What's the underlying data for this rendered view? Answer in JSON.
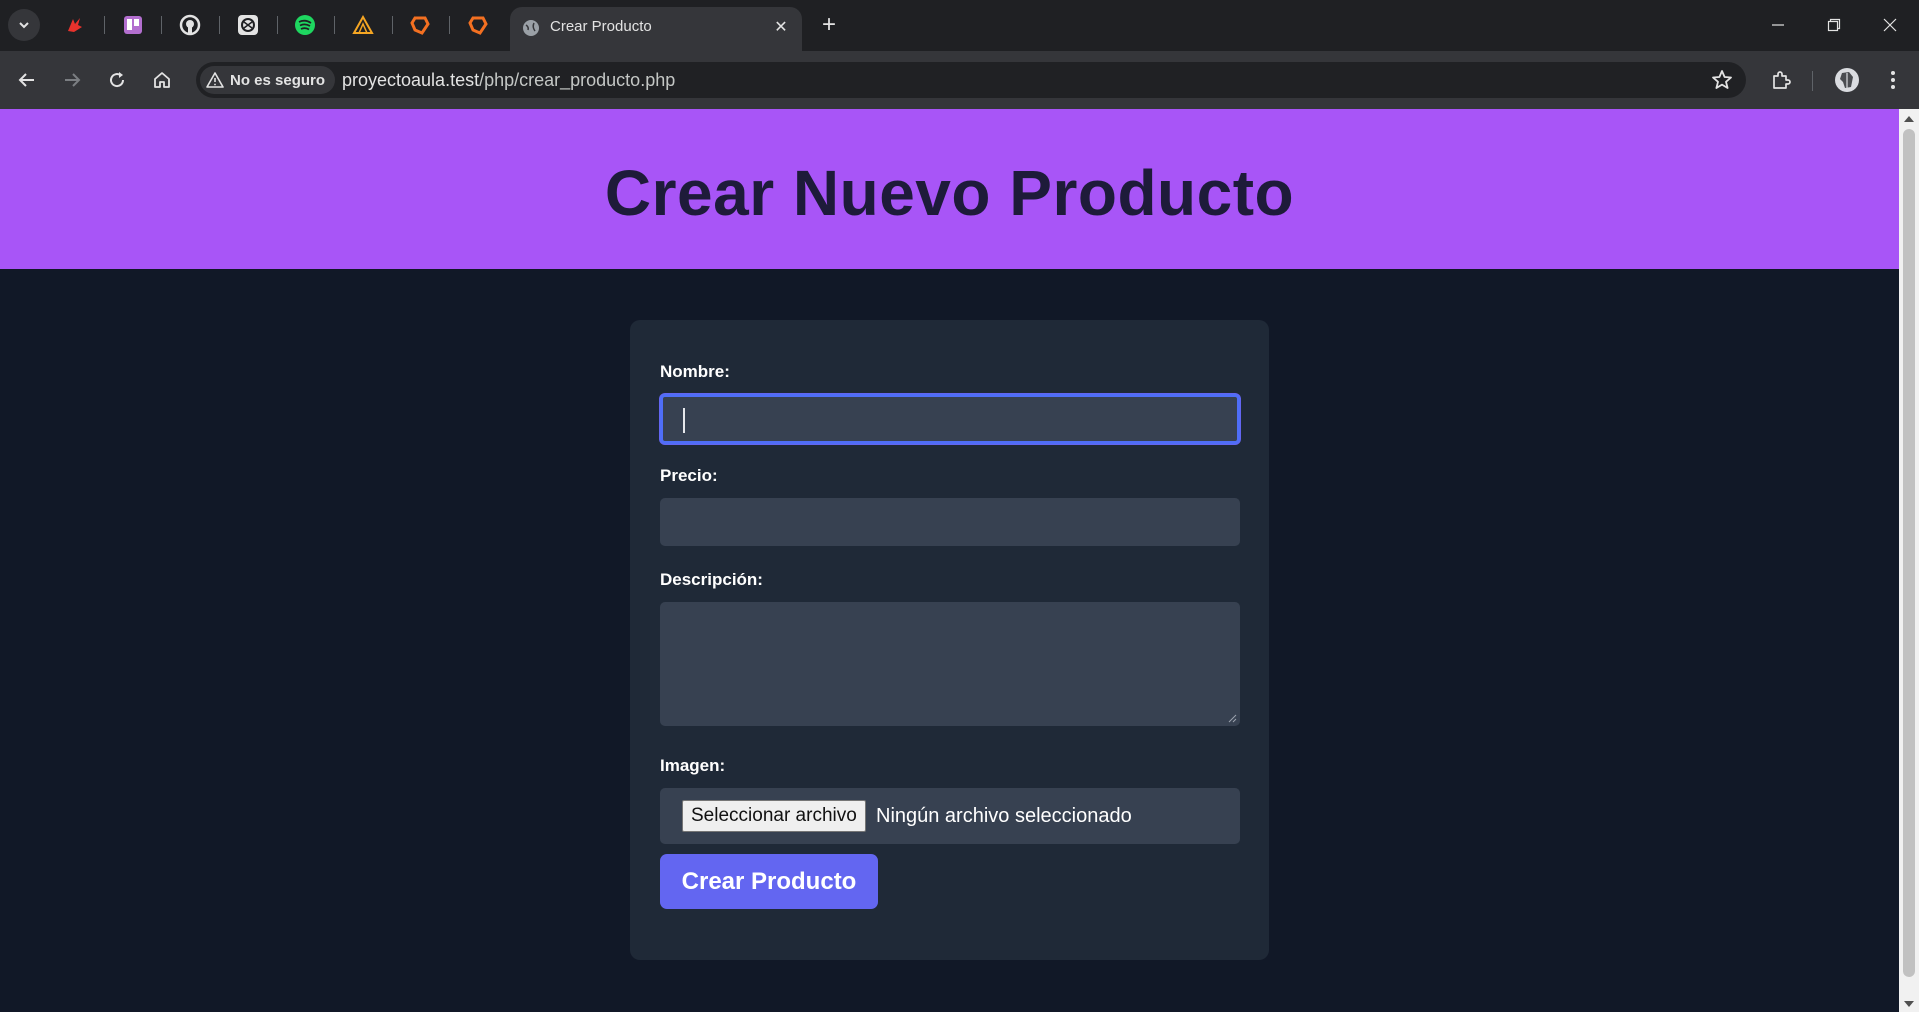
{
  "browser": {
    "tab_title": "Crear Producto",
    "security_chip": "No es seguro",
    "url_host": "proyectoaula.test",
    "url_path": "/php/crear_producto.php",
    "pinned_tabs": [
      "git-icon",
      "trello-icon",
      "github-icon",
      "chatgpt-icon",
      "spotify-icon",
      "vercel-icon",
      "logo-icon",
      "logo-icon"
    ]
  },
  "page": {
    "header_title": "Crear Nuevo Producto",
    "form": {
      "name_label": "Nombre:",
      "name_value": "",
      "price_label": "Precio:",
      "price_value": "",
      "description_label": "Descripción:",
      "description_value": "",
      "image_label": "Imagen:",
      "file_button": "Seleccionar archivo",
      "file_status": "Ningún archivo seleccionado",
      "submit_label": "Crear Producto"
    }
  },
  "colors": {
    "header_bg": "#a855f7",
    "page_bg": "#111827",
    "card_bg": "#1f2937",
    "input_bg": "#374151",
    "button_bg": "#6366f1",
    "focus_ring": "#4f6ef7"
  }
}
